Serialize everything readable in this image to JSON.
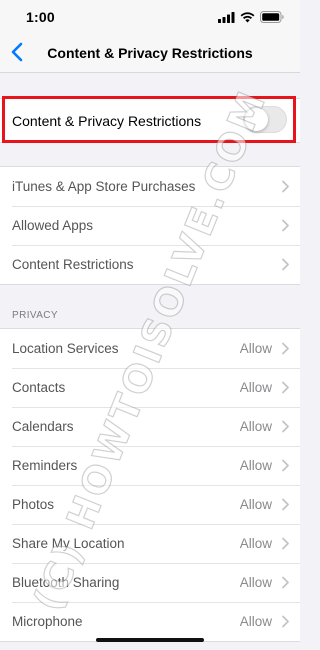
{
  "status_bar": {
    "time": "1:00",
    "icons": [
      "cellular-signal-icon",
      "wifi-icon",
      "battery-icon"
    ]
  },
  "nav": {
    "title": "Content & Privacy Restrictions",
    "back_icon": "chevron-left-icon"
  },
  "toggle_section": {
    "label": "Content & Privacy Restrictions",
    "enabled": false
  },
  "store_section": {
    "items": [
      {
        "label": "iTunes & App Store Purchases"
      },
      {
        "label": "Allowed Apps"
      },
      {
        "label": "Content Restrictions"
      }
    ]
  },
  "privacy_section": {
    "header": "PRIVACY",
    "items": [
      {
        "label": "Location Services",
        "value": "Allow"
      },
      {
        "label": "Contacts",
        "value": "Allow"
      },
      {
        "label": "Calendars",
        "value": "Allow"
      },
      {
        "label": "Reminders",
        "value": "Allow"
      },
      {
        "label": "Photos",
        "value": "Allow"
      },
      {
        "label": "Share My Location",
        "value": "Allow"
      },
      {
        "label": "Bluetooth Sharing",
        "value": "Allow"
      },
      {
        "label": "Microphone",
        "value": "Allow"
      }
    ]
  },
  "watermark": "(C) HOWTOISOLVE.COM",
  "colors": {
    "accent": "#007aff",
    "highlight": "#e8141b",
    "background": "#f2f2f7"
  }
}
